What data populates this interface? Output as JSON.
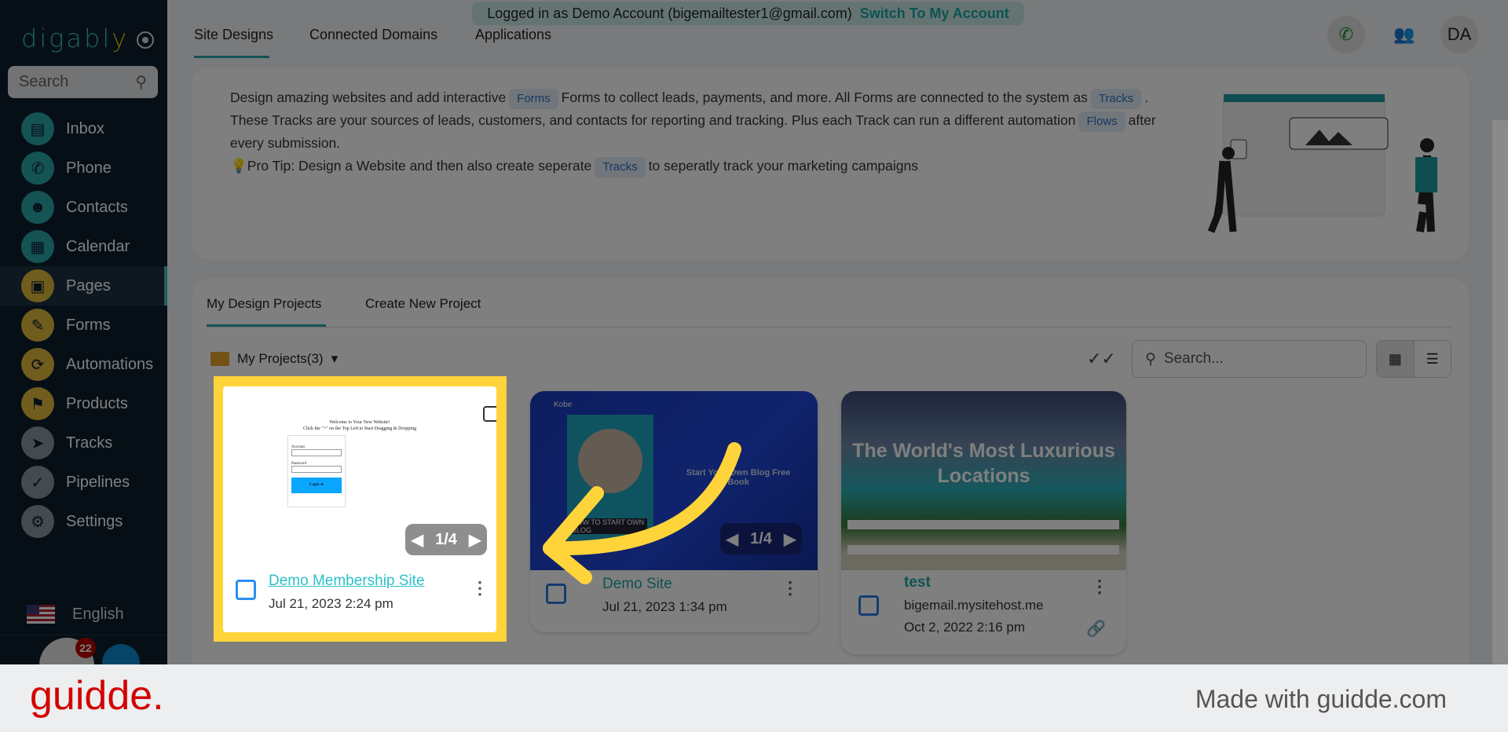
{
  "sidebar": {
    "logo": "digably",
    "search_placeholder": "Search",
    "items": [
      {
        "label": "Inbox",
        "icon": "inbox-icon"
      },
      {
        "label": "Phone",
        "icon": "phone-icon"
      },
      {
        "label": "Contacts",
        "icon": "contacts-icon"
      },
      {
        "label": "Calendar",
        "icon": "calendar-icon"
      },
      {
        "label": "Pages",
        "icon": "pages-icon",
        "active": true
      },
      {
        "label": "Forms",
        "icon": "pencil-icon"
      },
      {
        "label": "Automations",
        "icon": "refresh-icon"
      },
      {
        "label": "Products",
        "icon": "tag-icon"
      },
      {
        "label": "Tracks",
        "icon": "directions-icon"
      },
      {
        "label": "Pipelines",
        "icon": "check-circle-icon"
      },
      {
        "label": "Settings",
        "icon": "gear-icon"
      }
    ],
    "language": "English",
    "notification_count": "22"
  },
  "banner": {
    "text": "Logged in as Demo Account (bigemailtester1@gmail.com)",
    "switch_label": "Switch To My Account"
  },
  "tabs": [
    "Site Designs",
    "Connected Domains",
    "Applications"
  ],
  "header": {
    "avatar_initials": "DA"
  },
  "info": {
    "line1a": "Design amazing websites and add interactive",
    "chip_forms": "Forms",
    "line1b": "Forms to collect leads, payments, and more. All Forms are connected to the system as",
    "chip_tracks": "Tracks",
    "line2a": "These Tracks are your sources of leads, customers, and contacts for reporting and tracking. Plus each Track can run a different automation",
    "chip_flows": "Flows",
    "line2b": "after every submission.",
    "tip_a": "Pro Tip: Design a Website and then also create seperate",
    "tip_b": "to seperatly track your marketing campaigns"
  },
  "projects": {
    "tabs": [
      "My Design Projects",
      "Create New Project"
    ],
    "folder": "My Projects(3)",
    "search_placeholder": "Search...",
    "items": [
      {
        "title": "Demo Membership Site",
        "date": "Jul 21, 2023 2:24 pm",
        "pager": "1/4"
      },
      {
        "title": "Demo Site",
        "date": "Jul 21, 2023 1:34 pm",
        "pager": "1/4",
        "thumb_heading": "Start Your Own Blog Free Book",
        "thumb_brand": "Kobe",
        "thumb_card": "HOW TO START OWN BLOG"
      },
      {
        "title": "test",
        "domain": "bigemail.mysitehost.me",
        "date": "Oct 2, 2022 2:16 pm",
        "thumb_heading": "The World's Most Luxurious Locations"
      }
    ],
    "thumb1": {
      "welcome": "Welcome to Your New Website!",
      "hint": "Click the \"+\" on the Top Left to Start Dragging & Dropping",
      "account": "Account",
      "password": "Password",
      "login": "Login ➔"
    }
  },
  "footer": {
    "brand": "guidde.",
    "made_with": "Made with guidde.com"
  },
  "colors": {
    "accent": "#2aa7ab",
    "highlight": "#ffd43b",
    "sidebar": "#0d1f2d",
    "guidde_red": "#d40000"
  }
}
